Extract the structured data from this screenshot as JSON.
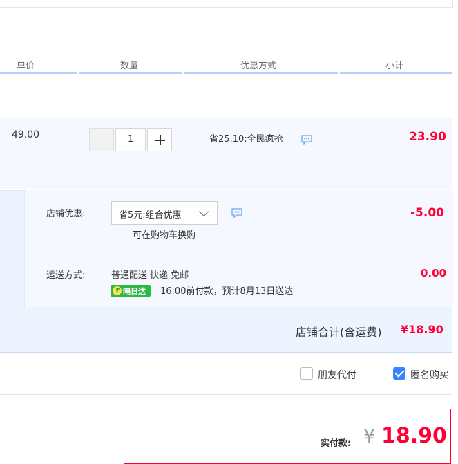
{
  "header": {
    "columns": [
      "单价",
      "数量",
      "优惠方式",
      "小计"
    ]
  },
  "item": {
    "unit_price": "49.00",
    "quantity": "1",
    "promo": "省25.10:全民疯抢",
    "subtotal": "23.90"
  },
  "shop": {
    "discount_label": "店铺优惠:",
    "discount_option": "省5元:组合优惠",
    "swap_note": "可在购物车换购",
    "discount_amount": "-5.00",
    "shipping_label": "运送方式:",
    "shipping_method": "普通配送 快递 免邮",
    "next_day_badge": "隔日达",
    "delivery_note": "16:00前付款，预计8月13日送达",
    "shipping_fee": "0.00",
    "total_label": "店铺合计(含运费)",
    "total_amount": "¥18.90"
  },
  "options": {
    "friend_pay": "朋友代付",
    "anonymous": "匿名购买"
  },
  "payment": {
    "label": "实付款:",
    "currency": "¥",
    "amount": "18.90"
  },
  "colors": {
    "accent_red": "#ff0036",
    "header_line": "#b2d1ff",
    "row_bg": "#f5f9ff",
    "checkbox_blue": "#3a83ff",
    "badge_green": "#2bb845"
  }
}
